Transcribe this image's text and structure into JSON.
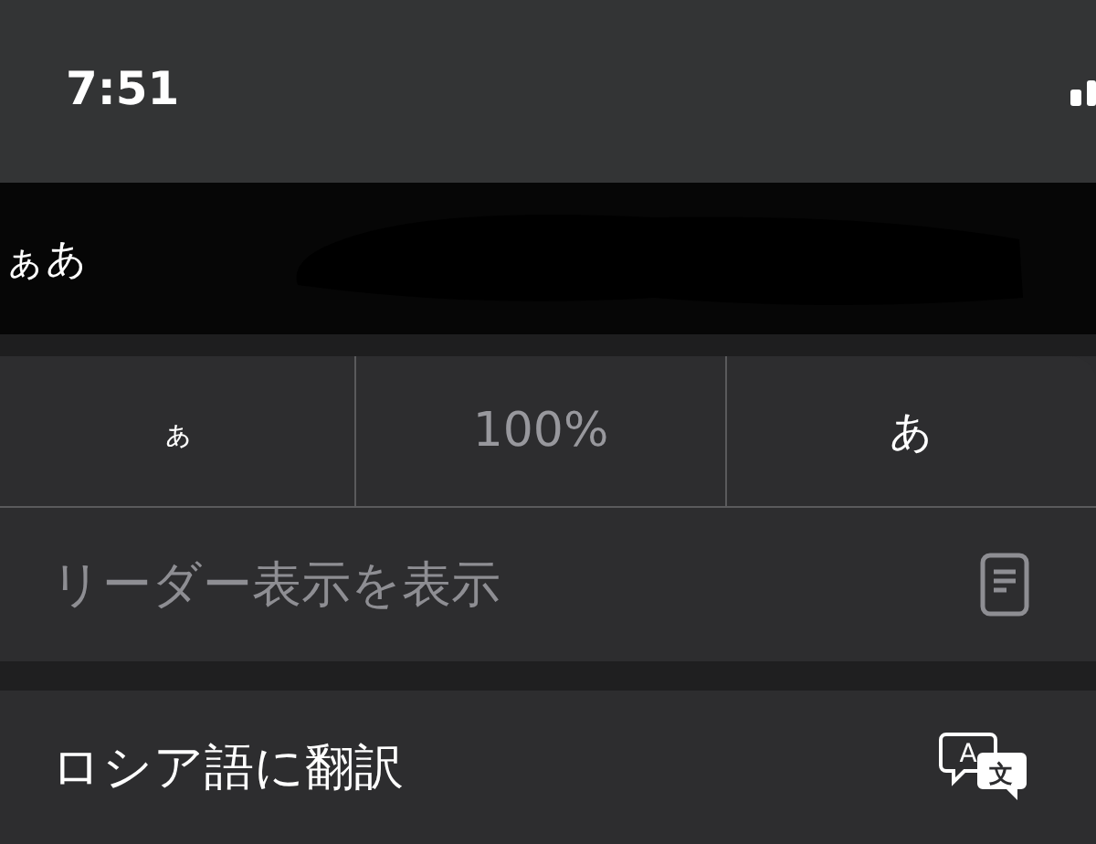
{
  "status_bar": {
    "time": "7:51"
  },
  "address_bar": {
    "text_size_button": "ぁあ",
    "redacted": true
  },
  "menu": {
    "text_size": {
      "smaller": "ぁ",
      "zoom": "100%",
      "larger": "あ"
    },
    "items": [
      {
        "kind": "reader",
        "label": "リーダー表示を表示",
        "disabled": true
      },
      {
        "kind": "translate",
        "label": "ロシア語に翻訳",
        "disabled": false,
        "icon_glyphs": [
          "A",
          "文"
        ]
      }
    ]
  }
}
